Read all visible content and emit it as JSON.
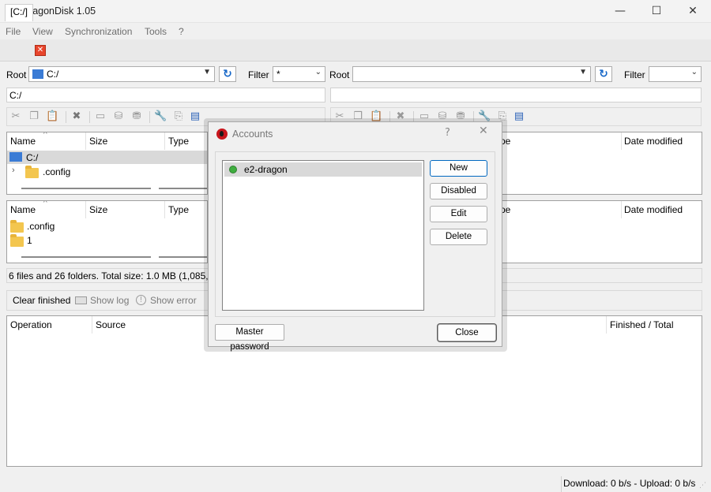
{
  "window": {
    "title": "DragonDisk 1.05"
  },
  "menu": [
    "File",
    "View",
    "Synchronization",
    "Tools",
    "?"
  ],
  "tabs": [
    {
      "label": "[C:/]"
    }
  ],
  "left": {
    "root_label": "Root",
    "root_value": "C:/",
    "filter_label": "Filter",
    "filter_value": "*",
    "path": "C:/",
    "tree_headers": [
      "Name",
      "Size",
      "Type"
    ],
    "tree_rows": [
      {
        "name": "C:/"
      },
      {
        "name": ".config"
      }
    ],
    "list_headers": [
      "Name",
      "Size",
      "Type"
    ],
    "list_rows": [
      {
        "name": ".config"
      },
      {
        "name": "1"
      }
    ],
    "status": "6 files and 26 folders. Total size: 1.0 MB (1,085,982 b"
  },
  "right": {
    "root_label": "Root",
    "root_value": "",
    "filter_label": "Filter",
    "filter_value": "",
    "path": "",
    "tree_headers": [
      "pe",
      "Date modified"
    ],
    "list_headers": [
      "pe",
      "Date modified"
    ]
  },
  "queue": {
    "clear_finished": "Clear finished",
    "show_log": "Show log",
    "show_error": "Show error",
    "headers": [
      "Operation",
      "Source",
      "Finished / Total"
    ]
  },
  "statusbar": {
    "transfer": "Download: 0 b/s - Upload: 0 b/s"
  },
  "dialog": {
    "title": "Accounts",
    "help": "?",
    "accounts": [
      {
        "name": "e2-dragon"
      }
    ],
    "buttons": {
      "new": "New",
      "disabled": "Disabled",
      "edit": "Edit",
      "delete": "Delete",
      "master_password": "Master password",
      "close": "Close"
    }
  },
  "colors": {
    "logo": "#c8161d",
    "accent": "#0067c0",
    "online": "#3fae3f"
  }
}
